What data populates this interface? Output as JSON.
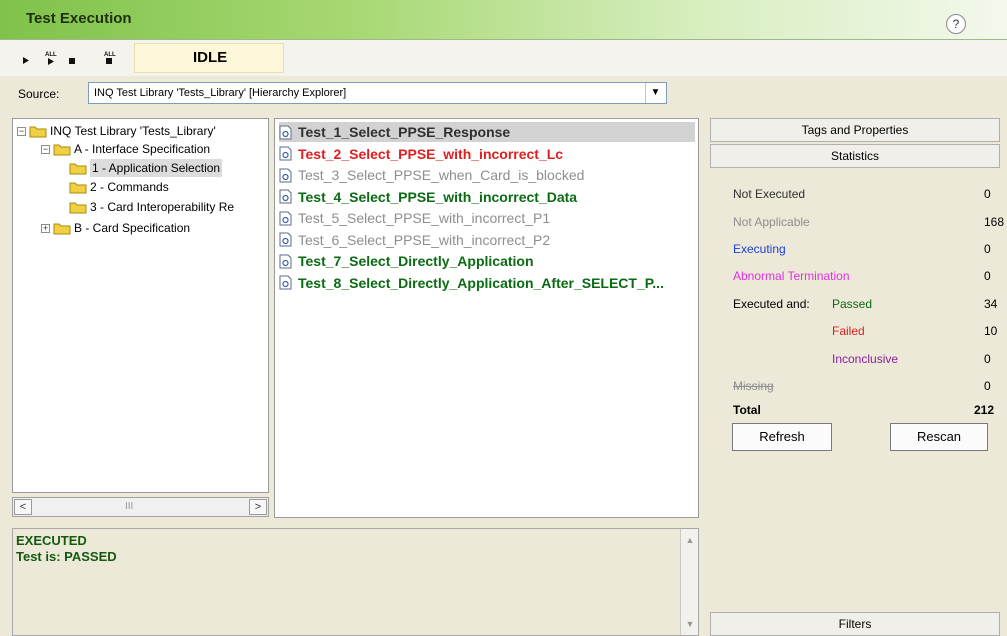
{
  "window": {
    "title": "Test Execution",
    "help_label": "?"
  },
  "toolbar": {
    "icons": [
      "play-icon",
      "play-all-icon",
      "stop-icon",
      "stop-all-icon"
    ],
    "all_label": "ALL",
    "status": "IDLE"
  },
  "source": {
    "label": "Source:",
    "value": "INQ Test Library 'Tests_Library' [Hierarchy Explorer]"
  },
  "tree": {
    "items": [
      {
        "label": "INQ Test Library 'Tests_Library'",
        "expander": "−",
        "selected": false
      },
      {
        "label": "A - Interface Specification",
        "expander": "−",
        "selected": false
      },
      {
        "label": "1 - Application Selection",
        "selected": true
      },
      {
        "label": "2 - Commands",
        "selected": false
      },
      {
        "label": "3 - Card Interoperability Re",
        "selected": false
      },
      {
        "label": "B - Card Specification",
        "expander": "+",
        "selected": false
      }
    ],
    "scroll_left": "<",
    "scroll_right": ">",
    "scroll_thumb": "III"
  },
  "tests": [
    {
      "name": "Test_1_Select_PPSE_Response",
      "status": "not-executed",
      "selected": true
    },
    {
      "name": "Test_2_Select_PPSE_with_incorrect_Lc",
      "status": "failed"
    },
    {
      "name": "Test_3_Select_PPSE_when_Card_is_blocked",
      "status": "not-applicable"
    },
    {
      "name": "Test_4_Select_PPSE_with_incorrect_Data",
      "status": "passed"
    },
    {
      "name": "Test_5_Select_PPSE_with_incorrect_P1",
      "status": "not-applicable"
    },
    {
      "name": "Test_6_Select_PPSE_with_incorrect_P2",
      "status": "not-applicable"
    },
    {
      "name": "Test_7_Select_Directly_Application",
      "status": "passed"
    },
    {
      "name": "Test_8_Select_Directly_Application_After_SELECT_P...",
      "status": "passed"
    }
  ],
  "right_panel": {
    "tags_tab": "Tags and Properties",
    "statistics_tab": "Statistics",
    "filters_tab": "Filters",
    "stats": {
      "not_executed": {
        "label": "Not Executed",
        "value": "0",
        "color": "#303030"
      },
      "not_applicable": {
        "label": "Not Applicable",
        "value": "168",
        "color": "#8e8e8e"
      },
      "executing": {
        "label": "Executing",
        "value": "0",
        "color": "#1f3fd0"
      },
      "abnormal": {
        "label": "Abnormal Termination",
        "value": "0",
        "color": "#e030e0"
      },
      "executed_and": {
        "label": "Executed and:"
      },
      "passed": {
        "label": "Passed",
        "value": "34",
        "color": "#0a6b12"
      },
      "failed": {
        "label": "Failed",
        "value": "10",
        "color": "#e02020"
      },
      "inconclusive": {
        "label": "Inconclusive",
        "value": "0",
        "color": "#8a1f9a"
      },
      "missing": {
        "label": "Missing",
        "value": "0",
        "color": "#8e8e8e"
      },
      "total": {
        "label": "Total",
        "value": "212"
      }
    },
    "refresh_label": "Refresh",
    "rescan_label": "Rescan"
  },
  "log": {
    "lines": [
      "EXECUTED",
      "Test is: PASSED"
    ],
    "scroll_up": "▲",
    "scroll_down": "▼"
  }
}
